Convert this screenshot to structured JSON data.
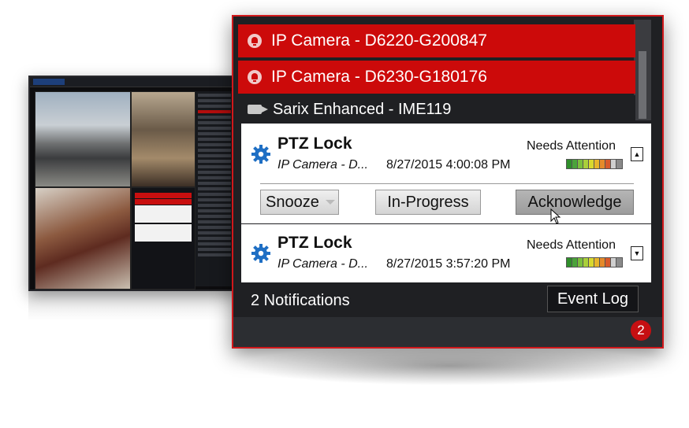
{
  "alarms": [
    {
      "label": "IP Camera - D6220-G200847"
    },
    {
      "label": "IP Camera - D6230-G180176"
    }
  ],
  "camera_row": {
    "label": "Sarix Enhanced - IME119"
  },
  "notifications": [
    {
      "title": "PTZ Lock",
      "source": "IP Camera - D...",
      "timestamp": "8/27/2015 4:00:08 PM",
      "status": "Needs Attention",
      "expanded": true,
      "severity_colors": [
        "#2f8f2a",
        "#4aa33a",
        "#7bbf3c",
        "#a9cf3a",
        "#d9d92e",
        "#e8b52a",
        "#e58a2a",
        "#d85a2a",
        "#cfcfcf",
        "#8a8a8a"
      ]
    },
    {
      "title": "PTZ Lock",
      "source": "IP Camera - D...",
      "timestamp": "8/27/2015 3:57:20 PM",
      "status": "Needs Attention",
      "expanded": false,
      "severity_colors": [
        "#2f8f2a",
        "#4aa33a",
        "#7bbf3c",
        "#a9cf3a",
        "#d9d92e",
        "#e8b52a",
        "#e58a2a",
        "#d85a2a",
        "#cfcfcf",
        "#8a8a8a"
      ]
    }
  ],
  "actions": {
    "snooze": "Snooze",
    "in_progress": "In-Progress",
    "acknowledge": "Acknowledge"
  },
  "footer": {
    "count_text": "2 Notifications",
    "event_log": "Event Log",
    "badge": "2"
  },
  "colors": {
    "accent": "#cc0a0a",
    "panel_bg": "#1f2023"
  }
}
